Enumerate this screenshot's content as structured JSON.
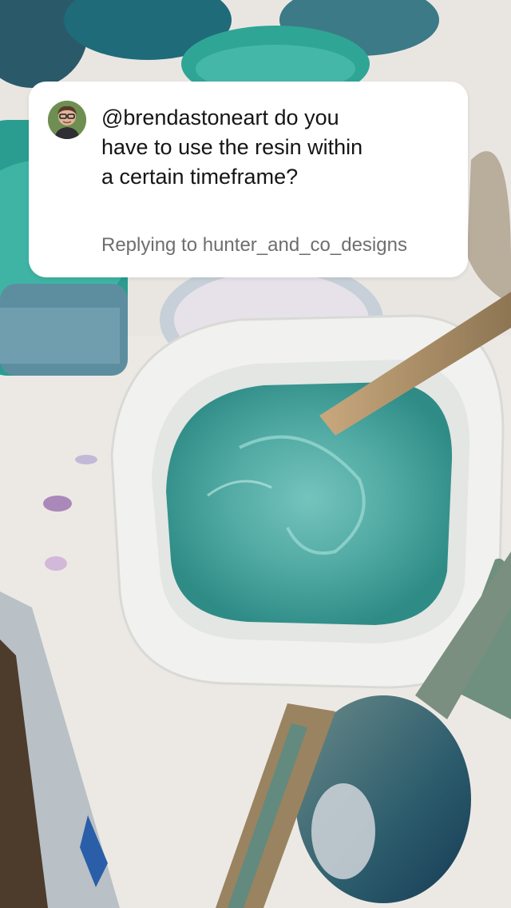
{
  "comment_reply": {
    "question": "@brendastoneart do you have to use the resin within a certain timeframe?",
    "replying_to": "Replying to hunter_and_co_designs"
  },
  "scene": {
    "description_icon": "resin-mixing-scene",
    "colors": {
      "resin_teal": "#4fa9a2",
      "cup_white": "#f1f1ef",
      "background": "#e9e6e2",
      "jar_teal": "#2ea89a"
    }
  }
}
